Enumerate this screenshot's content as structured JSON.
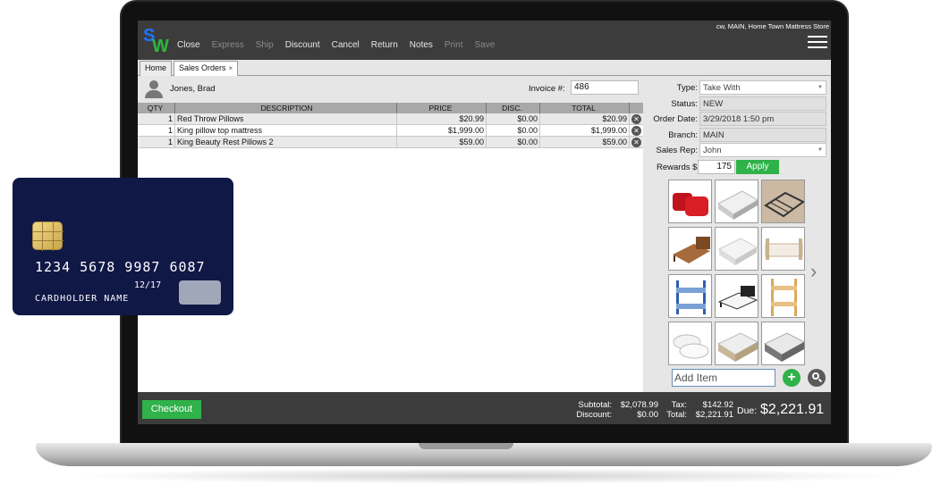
{
  "app": {
    "logo_s": "S",
    "logo_w": "W",
    "store_info": "cw, MAIN, Home Town Mattress Store"
  },
  "nav": {
    "close": "Close",
    "express": "Express",
    "ship": "Ship",
    "discount": "Discount",
    "cancel": "Cancel",
    "return": "Return",
    "notes": "Notes",
    "print": "Print",
    "save": "Save"
  },
  "tabs": {
    "home": "Home",
    "sales_orders": "Sales Orders",
    "close_symbol": "×"
  },
  "customer": {
    "name": "Jones, Brad",
    "invoice_label": "Invoice #:",
    "invoice_value": "486"
  },
  "table": {
    "headers": [
      "QTY",
      "DESCRIPTION",
      "PRICE",
      "DISC.",
      "TOTAL"
    ],
    "rows": [
      {
        "qty": "1",
        "description": "Red Throw Pillows",
        "price": "$20.99",
        "disc": "$0.00",
        "total": "$20.99"
      },
      {
        "qty": "1",
        "description": "King pillow top mattress",
        "price": "$1,999.00",
        "disc": "$0.00",
        "total": "$1,999.00"
      },
      {
        "qty": "1",
        "description": "King Beauty Rest Pillows 2",
        "price": "$59.00",
        "disc": "$0.00",
        "total": "$59.00"
      }
    ]
  },
  "details": {
    "type_label": "Type:",
    "type_value": "Take With",
    "status_label": "Status:",
    "status_value": "NEW",
    "order_date_label": "Order Date:",
    "order_date_value": "3/29/2018 1:50 pm",
    "branch_label": "Branch:",
    "branch_value": "MAIN",
    "sales_rep_label": "Sales Rep:",
    "sales_rep_value": "John",
    "rewards_label": "Rewards $",
    "rewards_value": "175",
    "apply_label": "Apply"
  },
  "products": [
    "red-pillows",
    "mattress-white",
    "bed-frame-metal",
    "platform-bed-wood",
    "mattress-topper",
    "daybed-white",
    "bunk-bed-blue",
    "platform-bed-black",
    "bunk-bed-wood",
    "pillows-white",
    "mattress-king",
    "mattress-grey"
  ],
  "add_item": {
    "placeholder": "Add Item",
    "add_symbol": "+"
  },
  "totals": {
    "subtotal_label": "Subtotal:",
    "subtotal_value": "$2,078.99",
    "discount_label": "Discount:",
    "discount_value": "$0.00",
    "tax_label": "Tax:",
    "tax_value": "$142.92",
    "total_label": "Total:",
    "total_value": "$2,221.91",
    "due_label": "Due:",
    "due_value": "$2,221.91",
    "checkout_label": "Checkout"
  },
  "card": {
    "number": "1234 5678 9987 6087",
    "expiry": "12/17",
    "holder": "CARDHOLDER NAME"
  },
  "colors": {
    "accent_green": "#2fb24a",
    "toolbar_bg": "#3c3c3c",
    "card_bg": "#101846"
  }
}
